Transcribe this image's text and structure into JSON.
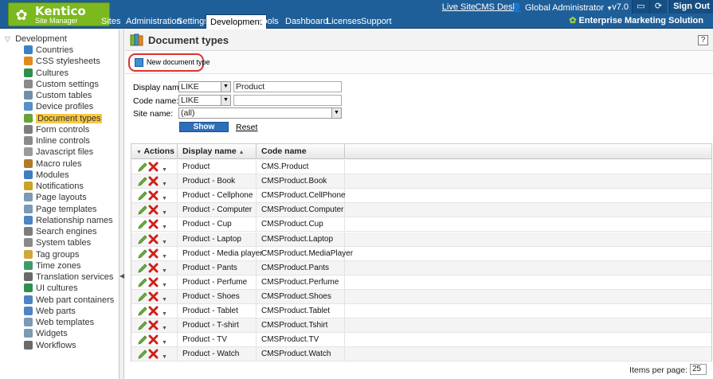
{
  "header": {
    "brand": "Kentico",
    "product": "Site Manager",
    "links": {
      "live_site": "Live Site",
      "cms_desk": "CMS Desk"
    },
    "user": "Global Administrator",
    "version": "v7.0",
    "sign_out": "Sign Out",
    "edition": "Enterprise Marketing Solution",
    "menu": [
      "Sites",
      "Administration",
      "Settings",
      "Development",
      "Tools",
      "Dashboard",
      "Licenses",
      "Support"
    ],
    "active_menu": "Development"
  },
  "tree": {
    "root": "Development",
    "items": [
      {
        "label": "Countries",
        "icon": "globe-icon",
        "color": "#3b82c4"
      },
      {
        "label": "CSS stylesheets",
        "icon": "brush-icon",
        "color": "#e08a1e"
      },
      {
        "label": "Cultures",
        "icon": "globe-icon",
        "color": "#2f8f4e"
      },
      {
        "label": "Custom settings",
        "icon": "wrench-icon",
        "color": "#8a8a8a"
      },
      {
        "label": "Custom tables",
        "icon": "table-icon",
        "color": "#6f8fa8"
      },
      {
        "label": "Device profiles",
        "icon": "device-icon",
        "color": "#5a8fc8"
      },
      {
        "label": "Document types",
        "icon": "book-icon",
        "color": "#6aa33a"
      },
      {
        "label": "Form controls",
        "icon": "form-icon",
        "color": "#7d7d7d"
      },
      {
        "label": "Inline controls",
        "icon": "inline-icon",
        "color": "#8a8a8a"
      },
      {
        "label": "Javascript files",
        "icon": "script-icon",
        "color": "#9a9a9a"
      },
      {
        "label": "Macro rules",
        "icon": "macro-icon",
        "color": "#b07a2a"
      },
      {
        "label": "Modules",
        "icon": "module-icon",
        "color": "#3f7fc0"
      },
      {
        "label": "Notifications",
        "icon": "notification-icon",
        "color": "#c9a227"
      },
      {
        "label": "Page layouts",
        "icon": "layout-icon",
        "color": "#7a9ab5"
      },
      {
        "label": "Page templates",
        "icon": "template-icon",
        "color": "#7a9ab5"
      },
      {
        "label": "Relationship names",
        "icon": "relationship-icon",
        "color": "#4c84c4"
      },
      {
        "label": "Search engines",
        "icon": "search-engine-icon",
        "color": "#7d7d7d"
      },
      {
        "label": "System tables",
        "icon": "system-table-icon",
        "color": "#8a8a8a"
      },
      {
        "label": "Tag groups",
        "icon": "tag-icon",
        "color": "#d0a83a"
      },
      {
        "label": "Time zones",
        "icon": "clock-icon",
        "color": "#3f9a6a"
      },
      {
        "label": "Translation services",
        "icon": "translation-icon",
        "color": "#6a6a6a"
      },
      {
        "label": "UI cultures",
        "icon": "ui-culture-icon",
        "color": "#2f8f4e"
      },
      {
        "label": "Web part containers",
        "icon": "container-icon",
        "color": "#4c84c4"
      },
      {
        "label": "Web parts",
        "icon": "webpart-icon",
        "color": "#4c84c4"
      },
      {
        "label": "Web templates",
        "icon": "web-template-icon",
        "color": "#7a9ab5"
      },
      {
        "label": "Widgets",
        "icon": "widget-icon",
        "color": "#7d9ab0"
      },
      {
        "label": "Workflows",
        "icon": "workflow-icon",
        "color": "#6a6a6a"
      }
    ],
    "selected": "Document types"
  },
  "page": {
    "title": "Document types",
    "help": "?",
    "new_button": "New document type",
    "filter": {
      "display_name_label": "Display name:",
      "display_name_op": "LIKE",
      "display_name_value": "Product",
      "code_name_label": "Code name:",
      "code_name_op": "LIKE",
      "code_name_value": "",
      "site_name_label": "Site name:",
      "site_name_value": "(all)",
      "show": "Show",
      "reset": "Reset"
    },
    "grid": {
      "columns": {
        "actions": "Actions",
        "display_name": "Display name",
        "code_name": "Code name"
      },
      "rows": [
        {
          "display_name": "Product",
          "code_name": "CMS.Product"
        },
        {
          "display_name": "Product - Book",
          "code_name": "CMSProduct.Book"
        },
        {
          "display_name": "Product - Cellphone",
          "code_name": "CMSProduct.CellPhone"
        },
        {
          "display_name": "Product - Computer",
          "code_name": "CMSProduct.Computer"
        },
        {
          "display_name": "Product - Cup",
          "code_name": "CMSProduct.Cup"
        },
        {
          "display_name": "Product - Laptop",
          "code_name": "CMSProduct.Laptop"
        },
        {
          "display_name": "Product - Media player",
          "code_name": "CMSProduct.MediaPlayer"
        },
        {
          "display_name": "Product - Pants",
          "code_name": "CMSProduct.Pants"
        },
        {
          "display_name": "Product - Perfume",
          "code_name": "CMSProduct.Perfume"
        },
        {
          "display_name": "Product - Shoes",
          "code_name": "CMSProduct.Shoes"
        },
        {
          "display_name": "Product - Tablet",
          "code_name": "CMSProduct.Tablet"
        },
        {
          "display_name": "Product - T-shirt",
          "code_name": "CMSProduct.Tshirt"
        },
        {
          "display_name": "Product - TV",
          "code_name": "CMSProduct.TV"
        },
        {
          "display_name": "Product - Watch",
          "code_name": "CMSProduct.Watch"
        }
      ]
    },
    "pager": {
      "label": "Items per page:",
      "value": "25"
    }
  }
}
